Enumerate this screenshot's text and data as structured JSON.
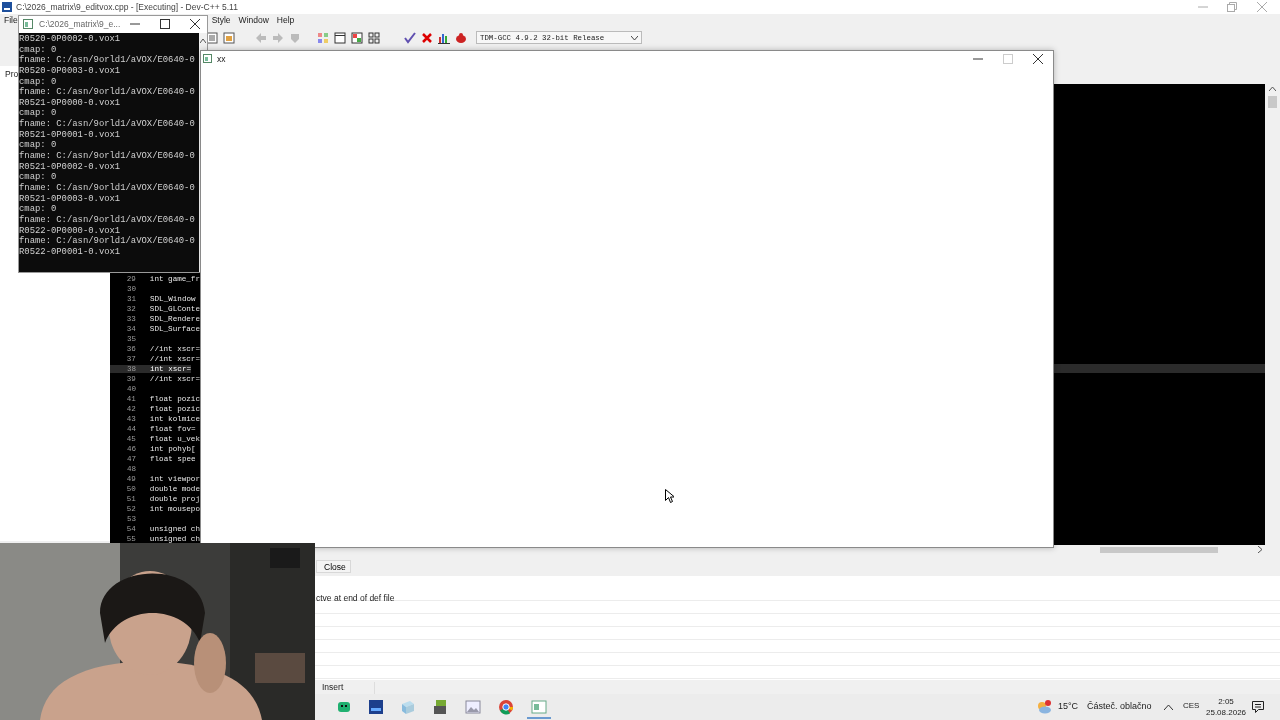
{
  "main_window": {
    "title": "C:\\2026_matrix\\9_editvox.cpp - [Executing] - Dev-C++ 5.11",
    "menu": [
      "File",
      "Style",
      "Window",
      "Help"
    ],
    "compiler": "TDM-GCC 4.9.2 32-bit Release",
    "project_tab": "Pro",
    "code_lines": [
      {
        "number": "29",
        "text": "int game_fr",
        "current": false
      },
      {
        "number": "30",
        "current": false
      },
      {
        "number": "31",
        "text": "SDL_Window",
        "current": false
      },
      {
        "number": "32",
        "text": "SDL_GLConte",
        "current": false
      },
      {
        "number": "33",
        "text": "SDL_Rendere",
        "current": false
      },
      {
        "number": "34",
        "text": "SDL_Surface",
        "current": false
      },
      {
        "number": "35",
        "current": false
      },
      {
        "number": "36",
        "text": "//int xscr=",
        "current": false
      },
      {
        "number": "37",
        "text": "//int xscr=",
        "current": false
      },
      {
        "number": "38",
        "text": "int xscr=",
        "current": true
      },
      {
        "number": "39",
        "text": "//int xscr=",
        "current": false
      },
      {
        "number": "40",
        "current": false
      },
      {
        "number": "41",
        "text": "float pozic",
        "current": false
      },
      {
        "number": "42",
        "text": "float pozic",
        "current": false
      },
      {
        "number": "43",
        "text": "int kolmice",
        "current": false
      },
      {
        "number": "44",
        "text": "float fov=",
        "current": false
      },
      {
        "number": "45",
        "text": "float u_vek",
        "current": false
      },
      {
        "number": "46",
        "text": "int pohyb[",
        "current": false
      },
      {
        "number": "47",
        "text": "float spee",
        "current": false
      },
      {
        "number": "48",
        "current": false
      },
      {
        "number": "49",
        "text": "int viewpor",
        "current": false
      },
      {
        "number": "50",
        "text": "double mode",
        "current": false
      },
      {
        "number": "51",
        "text": "double proj",
        "current": false
      },
      {
        "number": "52",
        "text": "int mousepo",
        "current": false
      },
      {
        "number": "53",
        "current": false
      },
      {
        "number": "54",
        "text": "unsigned ch",
        "current": false
      },
      {
        "number": "55",
        "text": "unsigned ch",
        "current": false
      }
    ],
    "close_button": "Close",
    "message": "ctve at end of def file",
    "status": "Insert"
  },
  "console_window": {
    "title": "C:\\2026_matrix\\9_e...",
    "lines": [
      "R0520-0P0002-0.vox1",
      "cmap: 0",
      "fname: C:/asn/9orld1/aVOX/E0640-0",
      "R0520-0P0003-0.vox1",
      "cmap: 0",
      "fname: C:/asn/9orld1/aVOX/E0640-0",
      "R0521-0P0000-0.vox1",
      "cmap: 0",
      "fname: C:/asn/9orld1/aVOX/E0640-0",
      "R0521-0P0001-0.vox1",
      "cmap: 0",
      "fname: C:/asn/9orld1/aVOX/E0640-0",
      "R0521-0P0002-0.vox1",
      "cmap: 0",
      "fname: C:/asn/9orld1/aVOX/E0640-0",
      "R0521-0P0003-0.vox1",
      "cmap: 0",
      "fname: C:/asn/9orld1/aVOX/E0640-0",
      "R0522-0P0000-0.vox1",
      "fname: C:/asn/9orld1/aVOX/E0640-0",
      "R0522-0P0001-0.vox1"
    ]
  },
  "output_window": {
    "title": "xx"
  },
  "taskbar": {
    "temperature": "15°C",
    "weather": "Částeč. oblačno",
    "language": "CES",
    "time": "2:05",
    "date": "25.08.2026"
  }
}
